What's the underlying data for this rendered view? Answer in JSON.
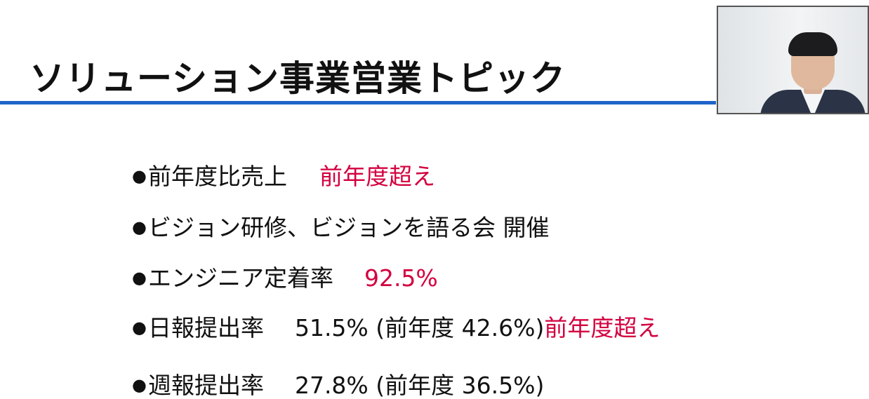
{
  "slide": {
    "title": "ソリューション事業営業トピック",
    "accent_color": "#1e64c8",
    "highlight_color": "#d3003f",
    "bullet_glyph": "●",
    "bullets": [
      {
        "label": "前年度比売上",
        "highlight": "前年度超え"
      },
      {
        "label": "ビジョン研修、ビジョンを語る会 開催"
      },
      {
        "label": "エンジニア定着率",
        "highlight": "92.5%"
      },
      {
        "label": "日報提出率",
        "value": "51.5% (前年度 42.6%)",
        "highlight": "前年度超え"
      },
      {
        "label": "週報提出率",
        "value": "27.8% (前年度 36.5%)"
      }
    ]
  },
  "webcam": {
    "icon": "presenter-video-feed"
  }
}
